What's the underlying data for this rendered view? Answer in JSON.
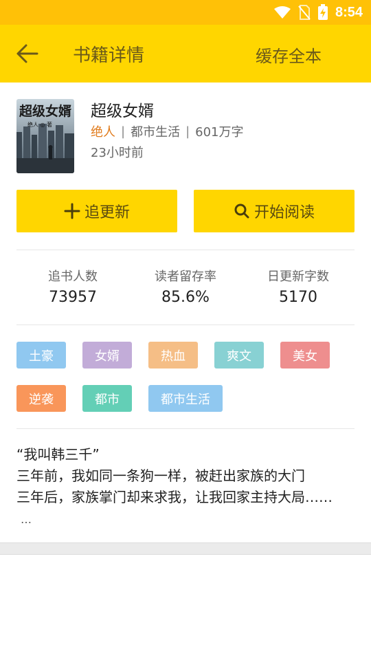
{
  "status": {
    "time": "8:54"
  },
  "appbar": {
    "title": "书籍详情",
    "action": "缓存全本"
  },
  "book": {
    "title": "超级女婿",
    "author": "绝人",
    "category": "都市生活",
    "words": "601万字",
    "updated": "23小时前",
    "cover_title": "超级女婿",
    "cover_author": "绝人 ◎ 著"
  },
  "buttons": {
    "follow_label": "追更新",
    "read_label": "开始阅读"
  },
  "stats": [
    {
      "label": "追书人数",
      "value": "73957"
    },
    {
      "label": "读者留存率",
      "value": "85.6%"
    },
    {
      "label": "日更新字数",
      "value": "5170"
    }
  ],
  "tags": [
    {
      "label": "土豪",
      "color": "#90C8F0"
    },
    {
      "label": "女婿",
      "color": "#C2ACD8"
    },
    {
      "label": "热血",
      "color": "#F5BE86"
    },
    {
      "label": "爽文",
      "color": "#88D1D3"
    },
    {
      "label": "美女",
      "color": "#EE8E8E"
    },
    {
      "label": "逆袭",
      "color": "#F9965A"
    },
    {
      "label": "都市",
      "color": "#63CFB6"
    },
    {
      "label": "都市生活",
      "color": "#90C8F0"
    }
  ],
  "description": {
    "lines": [
      "“我叫韩三千”",
      "三年前，我如同一条狗一样，被赶出家族的大门",
      "三年后，家族掌门却来求我，让我回家主持大局……"
    ],
    "more": "…"
  }
}
